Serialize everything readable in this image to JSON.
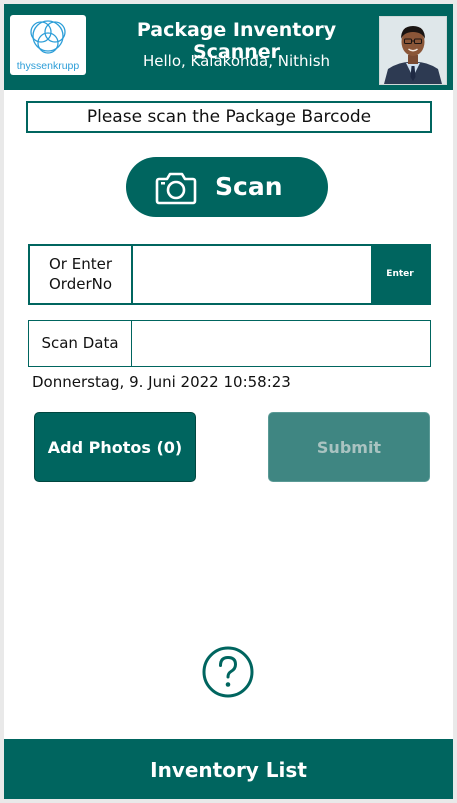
{
  "header": {
    "logo_text": "thyssenkrupp",
    "title": "Package Inventory Scanner",
    "greeting": "Hello, Kalakonda, Nithish"
  },
  "instruction": "Please scan the Package Barcode",
  "scan_button": {
    "label": "Scan",
    "icon": "camera-icon"
  },
  "order": {
    "label_line1": "Or Enter",
    "label_line2": "OrderNo",
    "value": "",
    "enter_label": "Enter"
  },
  "scan_data": {
    "label": "Scan Data",
    "value": ""
  },
  "timestamp": "Donnerstag, 9. Juni 2022 10:58:23",
  "actions": {
    "add_photos": "Add Photos (0)",
    "submit": "Submit"
  },
  "help_icon": "question-circle-icon",
  "footer": {
    "label": "Inventory List"
  },
  "colors": {
    "primary": "#00655f",
    "primary_disabled": "#3f8682",
    "logo_blue": "#2d9ed8"
  }
}
